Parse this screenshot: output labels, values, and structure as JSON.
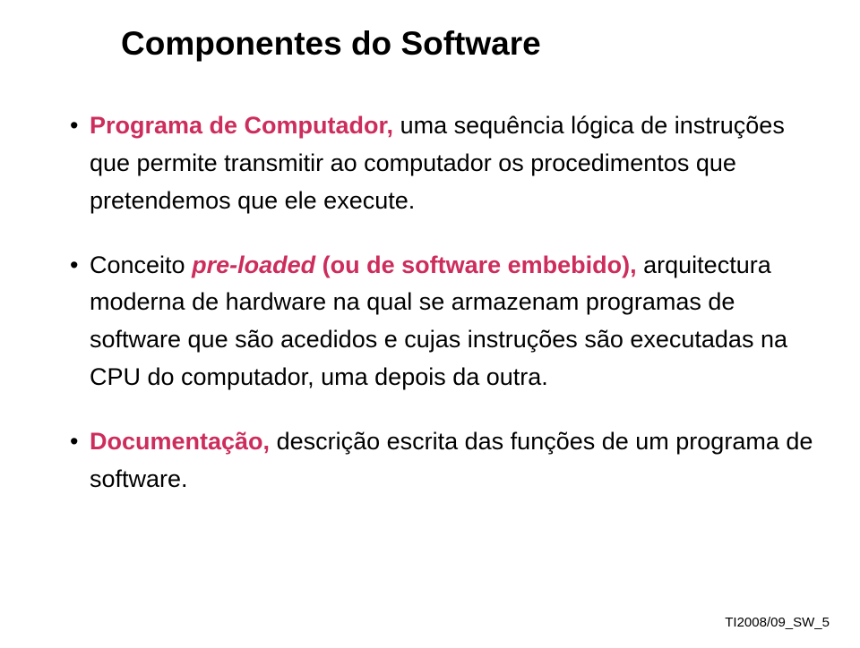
{
  "title": "Componentes do Software",
  "bullets": [
    {
      "term": "Programa de Computador,",
      "termClass": "term",
      "rest": " uma sequência lógica de instruções que permite transmitir ao computador os procedimentos que pretendemos que ele execute."
    },
    {
      "prefix": "Conceito ",
      "term": "pre-loaded",
      "termClass": "term-italic",
      "term2": " (ou de software embebido),",
      "term2Class": "term",
      "rest": " arquitectura moderna de hardware na qual se armazenam programas de software que são acedidos e cujas instruções são executadas na CPU do computador, uma depois da outra."
    },
    {
      "term": "Documentação,",
      "termClass": "term",
      "rest": " descrição escrita das funções de um programa de software."
    }
  ],
  "footer": "TI2008/09_SW_5"
}
